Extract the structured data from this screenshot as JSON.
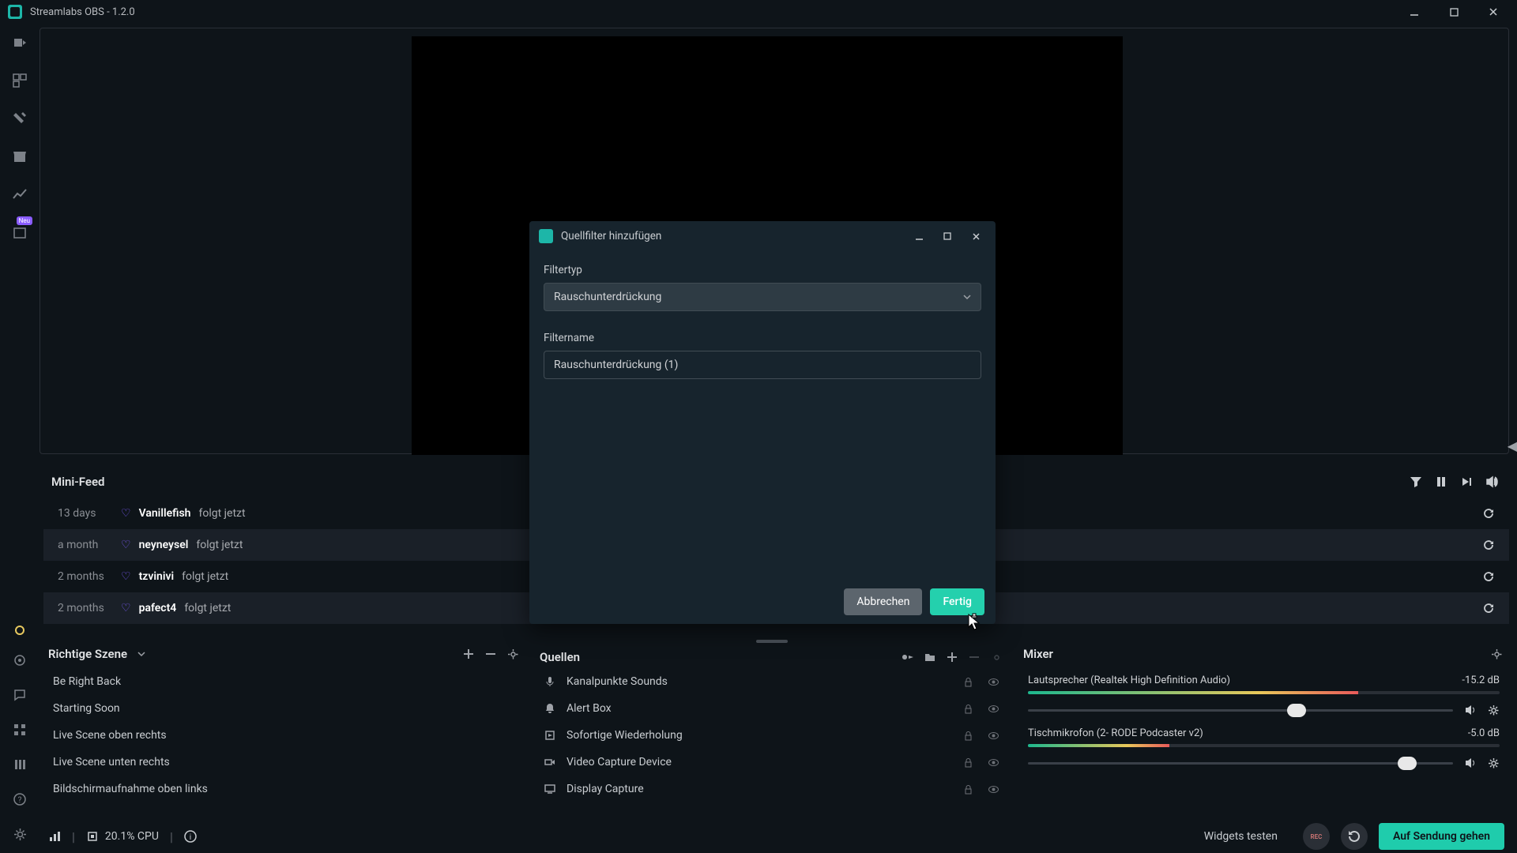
{
  "titlebar": {
    "title": "Streamlabs OBS - 1.2.0"
  },
  "leftrail": {
    "badge": "Neu"
  },
  "minifeed": {
    "title": "Mini-Feed",
    "items": [
      {
        "time": "13 days",
        "user": "Vanillefish",
        "action": "folgt jetzt"
      },
      {
        "time": "a month",
        "user": "neyneysel",
        "action": "folgt jetzt"
      },
      {
        "time": "2 months",
        "user": "tzvinivi",
        "action": "folgt jetzt"
      },
      {
        "time": "2 months",
        "user": "pafect4",
        "action": "folgt jetzt"
      }
    ]
  },
  "scenes": {
    "title": "Richtige Szene",
    "items": [
      "Be Right Back",
      "Starting Soon",
      "Live Scene oben rechts",
      "Live Scene unten rechts",
      "Bildschirmaufnahme oben links"
    ]
  },
  "sources": {
    "title": "Quellen",
    "items": [
      {
        "icon": "mic",
        "label": "Kanalpunkte Sounds"
      },
      {
        "icon": "bell",
        "label": "Alert Box"
      },
      {
        "icon": "replay",
        "label": "Sofortige Wiederholung"
      },
      {
        "icon": "camera",
        "label": "Video Capture Device"
      },
      {
        "icon": "monitor",
        "label": "Display Capture"
      }
    ]
  },
  "mixer": {
    "title": "Mixer",
    "items": [
      {
        "name": "Lautsprecher (Realtek High Definition Audio)",
        "db": "-15.2 dB",
        "level": 70,
        "thumb": 61
      },
      {
        "name": "Tischmikrofon (2- RODE Podcaster v2)",
        "db": "-5.0 dB",
        "level": 30,
        "thumb": 87
      }
    ]
  },
  "footer": {
    "cpu": "20.1% CPU",
    "widgets": "Widgets testen",
    "rec": "REC",
    "live": "Auf Sendung gehen"
  },
  "modal": {
    "title": "Quellfilter hinzufügen",
    "filtertype_label": "Filtertyp",
    "filtertype_value": "Rauschunterdrückung",
    "filtername_label": "Filtername",
    "filtername_value": "Rauschunterdrückung (1)",
    "cancel": "Abbrechen",
    "done": "Fertig"
  }
}
